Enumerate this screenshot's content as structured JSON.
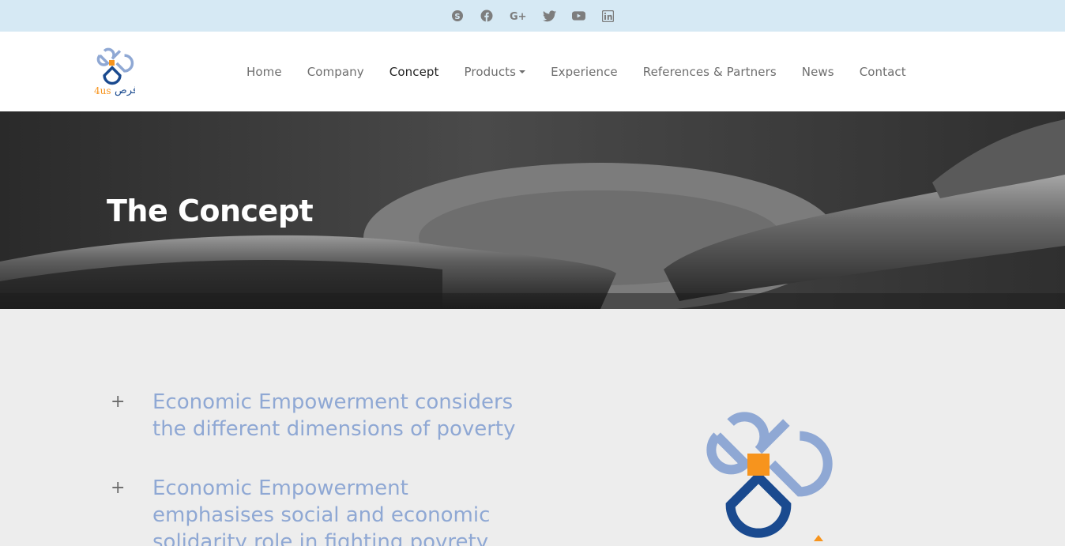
{
  "social": [
    {
      "name": "skype-icon"
    },
    {
      "name": "facebook-icon"
    },
    {
      "name": "google-plus-icon"
    },
    {
      "name": "twitter-icon"
    },
    {
      "name": "youtube-icon"
    },
    {
      "name": "linkedin-icon"
    }
  ],
  "brand": {
    "logo_text_latin": "4us",
    "logo_text_arabic": "فرص"
  },
  "nav": {
    "items": [
      {
        "label": "Home"
      },
      {
        "label": "Company"
      },
      {
        "label": "Concept"
      },
      {
        "label": "Products"
      },
      {
        "label": "Experience"
      },
      {
        "label": "References & Partners"
      },
      {
        "label": "News"
      },
      {
        "label": "Contact"
      }
    ],
    "active": "Concept"
  },
  "hero": {
    "title": "The Concept"
  },
  "content": {
    "items": [
      {
        "bullet": "+",
        "text": "Economic Empowerment considers the different dimensions of poverty"
      },
      {
        "bullet": "+",
        "text": "Economic Empowerment emphasises social and economic solidarity role in fighting povrety"
      }
    ]
  },
  "colors": {
    "topbar_bg": "#d6e9f4",
    "accent_blue_light": "#8fa8d4",
    "accent_blue_dark": "#1a4a8f",
    "accent_orange": "#f7941d"
  }
}
